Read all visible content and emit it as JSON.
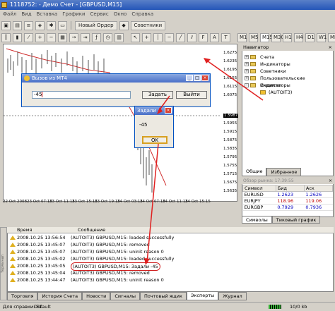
{
  "window": {
    "title": "1118752: - Демо Счет - [GBPUSD,M15]"
  },
  "menu": [
    "Файл",
    "Вид",
    "Вставка",
    "Графики",
    "Сервис",
    "Окно",
    "Справка"
  ],
  "toolbar": {
    "new_order": "Новый Ордер",
    "advisors": "Советники",
    "timeframes": [
      "M1",
      "M5",
      "M15",
      "M30",
      "H1",
      "H4",
      "D1",
      "W1",
      "MN"
    ]
  },
  "chart": {
    "prices": [
      "1.6275",
      "1.6235",
      "1.6195",
      "1.6155",
      "1.6115",
      "1.6075",
      "1.5987",
      "1.5955",
      "1.5915",
      "1.5875",
      "1.5835",
      "1.5795",
      "1.5755",
      "1.5715",
      "1.5675",
      "1.5635",
      "1.5595",
      "1.5555"
    ],
    "current_price": "1.5987",
    "dates": [
      "22 Oct 2008",
      "23 Oct 07:15",
      "23 Oct 11:15",
      "23 Oct 15:15",
      "23 Oct 19:15",
      "24 Oct 03:15",
      "24 Oct 07:15",
      "24 Oct 11:15",
      "24 Oct 15:15",
      "24 Oct 19:15"
    ]
  },
  "navigator": {
    "title": "Навигатор",
    "items": [
      "Счета",
      "Индикаторы",
      "Советники",
      "Пользовательские Индикаторы",
      "Скрипты",
      "(AUTOIT3)"
    ],
    "tabs": [
      "Общие",
      "Избранное"
    ]
  },
  "market_watch": {
    "title": "Обзор рынка: 17:39:55",
    "headers": [
      "Символ",
      "Бид",
      "Аск"
    ],
    "rows": [
      {
        "symbol": "EURUSD",
        "bid": "1.2623",
        "ask": "1.2626"
      },
      {
        "symbol": "EURJPY",
        "bid": "118.96",
        "ask": "119.06"
      },
      {
        "symbol": "EURGBP",
        "bid": "0.7929",
        "ask": "0.7936"
      }
    ],
    "tabs": [
      "Символы",
      "Тиковый график"
    ]
  },
  "terminal": {
    "headers": [
      "Время",
      "Сообщение"
    ],
    "rows": [
      {
        "time": "2008.10.25 13:56:54",
        "msg": "(AUTOIT3) GBPUSD,M15: loaded successfully"
      },
      {
        "time": "2008.10.25 13:45:07",
        "msg": "(AUTOIT3) GBPUSD,M15: removed"
      },
      {
        "time": "2008.10.25 13:45:07",
        "msg": "(AUTOIT3) GBPUSD,M15: uninit reason 0"
      },
      {
        "time": "2008.10.25 13:45:02",
        "msg": "(AUTOIT3) GBPUSD,M15: loaded successfully"
      },
      {
        "time": "2008.10.25 13:45:05",
        "msg": "(AUTOIT3) GBPUSD,M15: Задали -45"
      },
      {
        "time": "2008.10.25 13:45:04",
        "msg": "(AUTOIT3) GBPUSD,M15: removed"
      },
      {
        "time": "2008.10.25 13:44:47",
        "msg": "(AUTOIT3) GBPUSD,M15: uninit reason 0"
      }
    ],
    "tabs": [
      "Торговля",
      "История Счета",
      "Новости",
      "Сигналы",
      "Почтовый ящик",
      "Эксперты",
      "Журнал"
    ],
    "side_label": "Терминал"
  },
  "dialog_call": {
    "title": "Вызов из MT4",
    "value": "-45",
    "set_button": "Задать",
    "exit_button": "Выйти"
  },
  "dialog_set": {
    "title": "Задали",
    "message": "-45",
    "ok": "OK"
  },
  "status": {
    "help": "Для справки: F1",
    "profile": "Default",
    "traffic": "10/0 kb"
  }
}
